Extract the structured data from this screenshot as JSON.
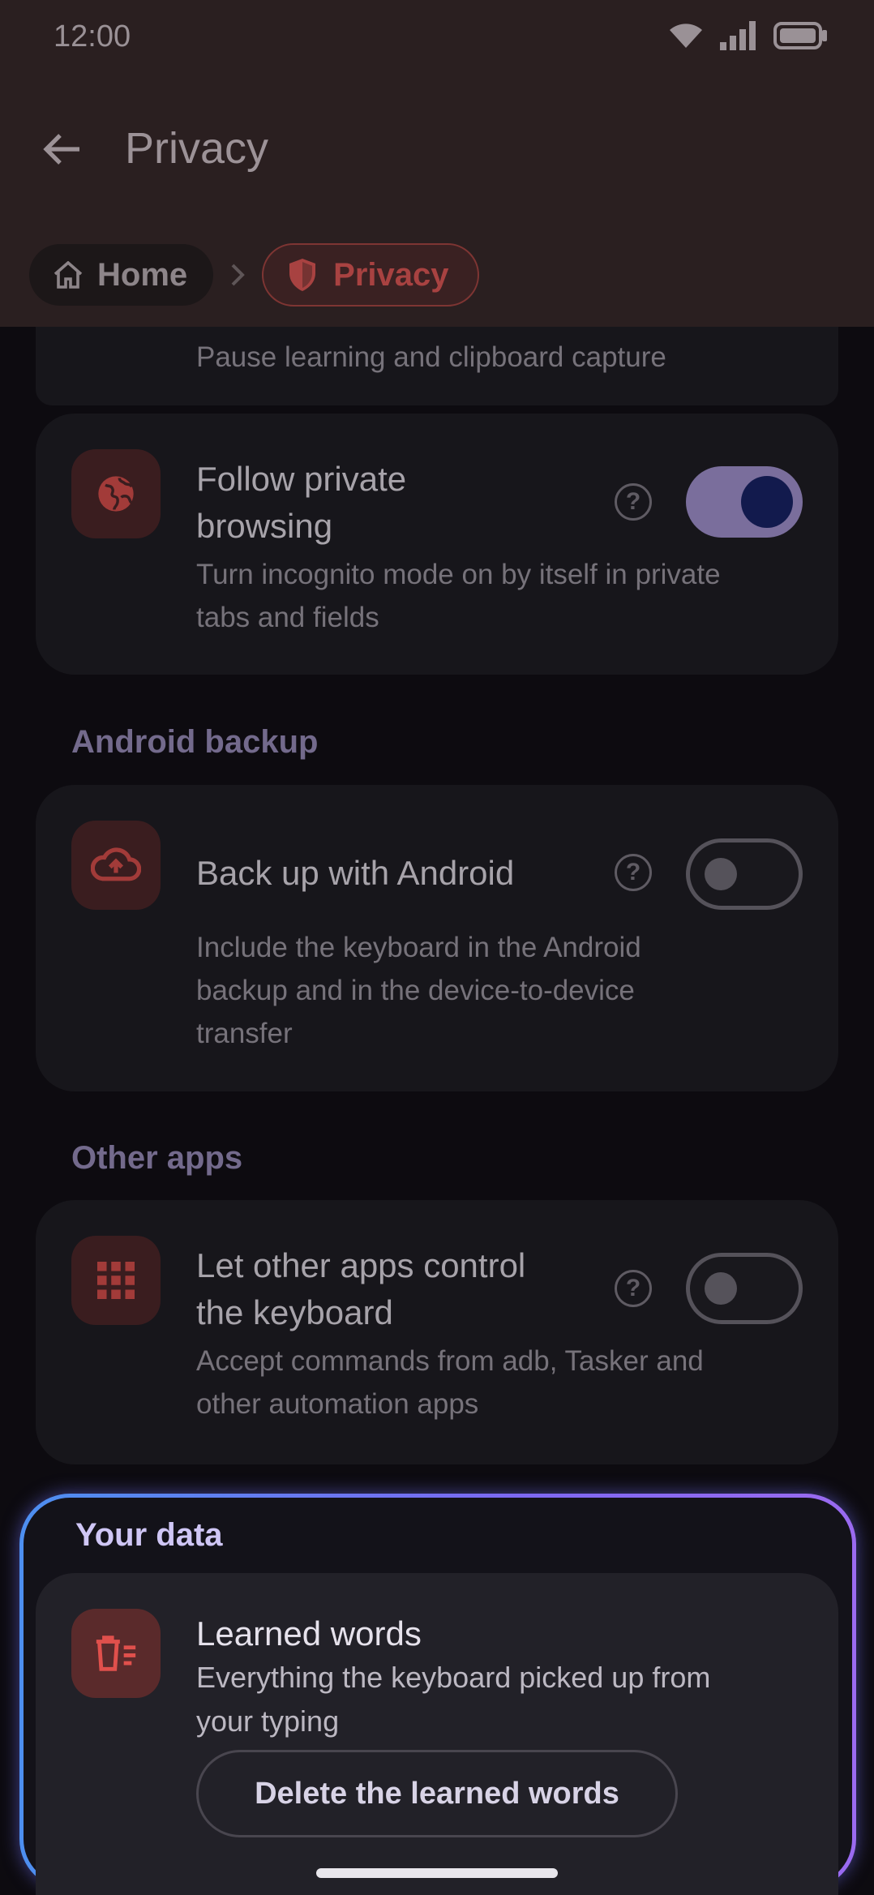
{
  "status_bar": {
    "time": "12:00"
  },
  "header": {
    "title": "Privacy",
    "breadcrumbs": [
      {
        "label": "Home",
        "icon": "home-icon"
      },
      {
        "label": "Privacy",
        "icon": "shield-icon"
      }
    ]
  },
  "rows": {
    "incognito_partial": {
      "subtitle": "Pause learning and clipboard capture"
    },
    "follow_private": {
      "title_line1": "Follow private",
      "title_line2": "browsing",
      "subtitle_line1": "Turn incognito mode on by itself in private",
      "subtitle_line2": "tabs and fields",
      "icon": "globe-icon",
      "enabled": true
    },
    "backup_section": "Android backup",
    "backup": {
      "title": "Back up with Android",
      "subtitle_line1": "Include the keyboard in the Android",
      "subtitle_line2": "backup and in the device-to-device",
      "subtitle_line3": "transfer",
      "icon": "cloud-upload-icon",
      "enabled": false
    },
    "other_apps_section": "Other apps",
    "other_apps": {
      "title_line1": "Let other apps control",
      "title_line2": "the keyboard",
      "subtitle_line1": "Accept commands from adb, Tasker and",
      "subtitle_line2": "other automation apps",
      "icon": "grid-icon",
      "enabled": false
    },
    "your_data_section": "Your data",
    "learned_words": {
      "title": "Learned words",
      "subtitle_line1": "Everything the keyboard picked up from",
      "subtitle_line2": "your typing",
      "button": "Delete the learned words",
      "icon": "delete-list-icon"
    }
  },
  "help_glyph": "?",
  "colors": {
    "accent_red": "#a84241",
    "highlight_blue": "#4d8ff0",
    "highlight_purple": "#9a6af0",
    "toggle_on": "#7a6e9c"
  }
}
